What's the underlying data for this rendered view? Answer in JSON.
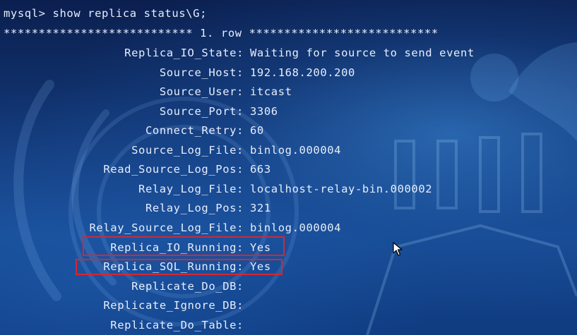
{
  "terminal": {
    "command_line": "mysql> show replica status\\G;",
    "row_separator": "*************************** 1. row ***************************",
    "rows": [
      {
        "field": "Replica_IO_State:",
        "value": "Waiting for source to send event"
      },
      {
        "field": "Source_Host:",
        "value": "192.168.200.200"
      },
      {
        "field": "Source_User:",
        "value": "itcast"
      },
      {
        "field": "Source_Port:",
        "value": "3306"
      },
      {
        "field": "Connect_Retry:",
        "value": "60"
      },
      {
        "field": "Source_Log_File:",
        "value": "binlog.000004"
      },
      {
        "field": "Read_Source_Log_Pos:",
        "value": "663"
      },
      {
        "field": "Relay_Log_File:",
        "value": "localhost-relay-bin.000002"
      },
      {
        "field": "Relay_Log_Pos:",
        "value": "321"
      },
      {
        "field": "Relay_Source_Log_File:",
        "value": "binlog.000004"
      },
      {
        "field": "Replica_IO_Running:",
        "value": "Yes"
      },
      {
        "field": "Replica_SQL_Running:",
        "value": "Yes"
      },
      {
        "field": "Replicate_Do_DB:",
        "value": ""
      },
      {
        "field": "Replicate_Ignore_DB:",
        "value": ""
      },
      {
        "field": "Replicate_Do_Table:",
        "value": ""
      }
    ]
  },
  "colors": {
    "text": "#e6eefc",
    "highlight_border": "#d8262e",
    "background_top": "#0b1f4f",
    "background_bottom": "#174a92"
  },
  "icons": {
    "cursor": "mouse-pointer-icon"
  }
}
